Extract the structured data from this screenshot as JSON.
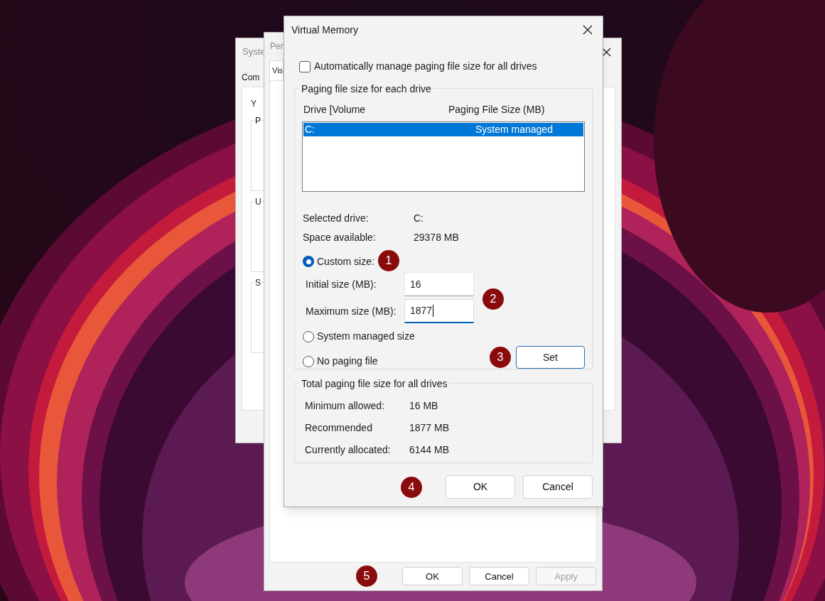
{
  "system_window": {
    "title": "Syste",
    "tab": "Com",
    "heading": "Y",
    "groups": [
      "P",
      "U",
      "S"
    ]
  },
  "performance_window": {
    "title": "Per",
    "tab": "Vis",
    "marker": "5",
    "buttons": [
      {
        "label": "OK",
        "disabled": false
      },
      {
        "label": "Cancel",
        "disabled": false
      },
      {
        "label": "Apply",
        "disabled": true
      }
    ]
  },
  "virtual_memory": {
    "title": "Virtual Memory",
    "auto_manage": {
      "label": "Automatically manage paging file size for all drives",
      "checked": false
    },
    "drives_group": {
      "title": "Paging file size for each drive",
      "columns": [
        "Drive [Volume",
        "Paging File Size (MB)"
      ],
      "rows": [
        {
          "drive": "C:",
          "size": "System managed",
          "selected": true
        }
      ],
      "info": [
        {
          "label": "Selected drive:",
          "value": "C:"
        },
        {
          "label": "Space available:",
          "value": "29378 MB"
        }
      ],
      "custom_size": {
        "label": "Custom size:",
        "selected": true,
        "marker": "1"
      },
      "size_fields": {
        "marker": "2",
        "fields": [
          {
            "label": "Initial size (MB):",
            "value": "16",
            "focused": false
          },
          {
            "label": "Maximum size (MB):",
            "value": "1877",
            "focused": true
          }
        ]
      },
      "other_options": [
        {
          "label": "System managed size",
          "selected": false
        },
        {
          "label": "No paging file",
          "selected": false
        }
      ],
      "set_button": {
        "label": "Set",
        "marker": "3",
        "default": true
      }
    },
    "totals": {
      "title": "Total paging file size for all drives",
      "rows": [
        {
          "label": "Minimum allowed:",
          "value": "16 MB"
        },
        {
          "label": "Recommended",
          "value": "1877 MB"
        },
        {
          "label": "Currently allocated:",
          "value": "6144 MB"
        }
      ]
    },
    "marker": "4",
    "buttons": [
      {
        "label": "OK"
      },
      {
        "label": "Cancel"
      }
    ]
  }
}
